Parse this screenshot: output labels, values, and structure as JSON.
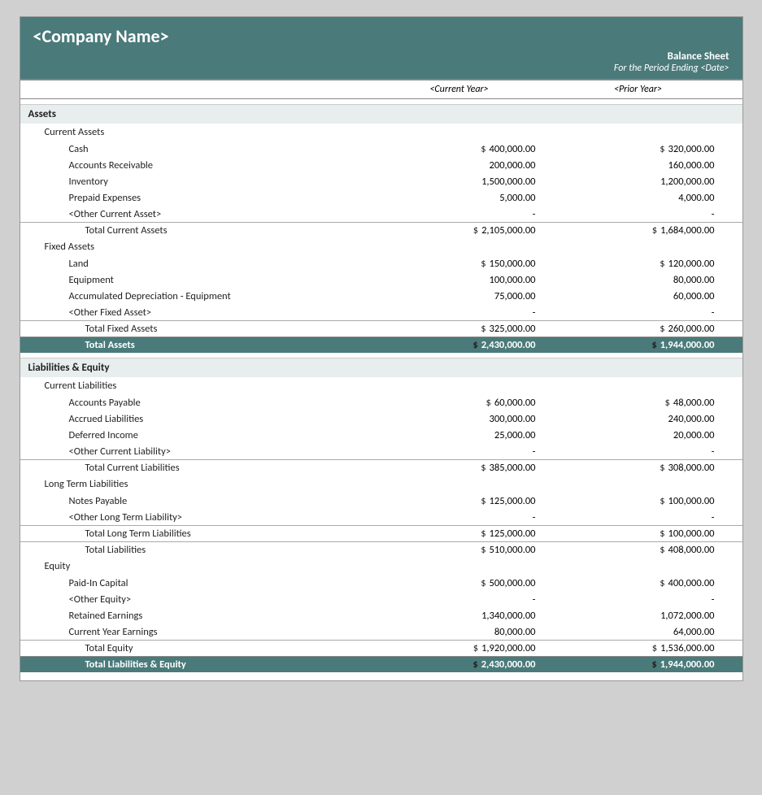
{
  "header": {
    "company_name": "<Company Name>",
    "doc_title": "Balance Sheet",
    "doc_subtitle": "For the Period Ending <Date>",
    "col_cy": "<Current Year>",
    "col_py": "<Prior Year>"
  },
  "sections": {
    "assets_label": "Assets",
    "current_assets_label": "Current Assets",
    "fixed_assets_label": "Fixed Assets",
    "liabilities_equity_label": "Liabilities & Equity",
    "current_liabilities_label": "Current Liabilities",
    "long_term_liabilities_label": "Long Term Liabilities",
    "equity_label": "Equity"
  },
  "rows": {
    "cash": {
      "label": "Cash",
      "cy": "400,000.00",
      "py": "320,000.00",
      "has_dollar_cy": true,
      "has_dollar_py": true
    },
    "accounts_receivable": {
      "label": "Accounts Receivable",
      "cy": "200,000.00",
      "py": "160,000.00"
    },
    "inventory": {
      "label": "Inventory",
      "cy": "1,500,000.00",
      "py": "1,200,000.00"
    },
    "prepaid_expenses": {
      "label": "Prepaid Expenses",
      "cy": "5,000.00",
      "py": "4,000.00"
    },
    "other_current_asset": {
      "label": "<Other Current Asset>",
      "cy": "-",
      "py": "-"
    },
    "total_current_assets": {
      "label": "Total Current Assets",
      "cy": "2,105,000.00",
      "py": "1,684,000.00",
      "has_dollar_cy": true,
      "has_dollar_py": true
    },
    "land": {
      "label": "Land",
      "cy": "150,000.00",
      "py": "120,000.00",
      "has_dollar_cy": true,
      "has_dollar_py": true
    },
    "equipment": {
      "label": "Equipment",
      "cy": "100,000.00",
      "py": "80,000.00"
    },
    "accum_depreciation": {
      "label": "Accumulated Depreciation - Equipment",
      "cy": "75,000.00",
      "py": "60,000.00"
    },
    "other_fixed_asset": {
      "label": "<Other Fixed Asset>",
      "cy": "-",
      "py": "-"
    },
    "total_fixed_assets": {
      "label": "Total Fixed Assets",
      "cy": "325,000.00",
      "py": "260,000.00",
      "has_dollar_cy": true,
      "has_dollar_py": true
    },
    "total_assets": {
      "label": "Total Assets",
      "cy": "2,430,000.00",
      "py": "1,944,000.00",
      "has_dollar_cy": true,
      "has_dollar_py": true
    },
    "accounts_payable": {
      "label": "Accounts Payable",
      "cy": "60,000.00",
      "py": "48,000.00",
      "has_dollar_cy": true,
      "has_dollar_py": true
    },
    "accrued_liabilities": {
      "label": "Accrued Liabilities",
      "cy": "300,000.00",
      "py": "240,000.00"
    },
    "deferred_income": {
      "label": "Deferred Income",
      "cy": "25,000.00",
      "py": "20,000.00"
    },
    "other_current_liability": {
      "label": "<Other Current Liability>",
      "cy": "-",
      "py": "-"
    },
    "total_current_liabilities": {
      "label": "Total Current Liabilities",
      "cy": "385,000.00",
      "py": "308,000.00",
      "has_dollar_cy": true,
      "has_dollar_py": true
    },
    "notes_payable": {
      "label": "Notes Payable",
      "cy": "125,000.00",
      "py": "100,000.00",
      "has_dollar_cy": true,
      "has_dollar_py": true
    },
    "other_lt_liability": {
      "label": "<Other Long Term Liability>",
      "cy": "-",
      "py": "-"
    },
    "total_lt_liabilities": {
      "label": "Total Long Term Liabilities",
      "cy": "125,000.00",
      "py": "100,000.00",
      "has_dollar_cy": true,
      "has_dollar_py": true
    },
    "total_liabilities": {
      "label": "Total Liabilities",
      "cy": "510,000.00",
      "py": "408,000.00",
      "has_dollar_cy": true,
      "has_dollar_py": true
    },
    "paid_in_capital": {
      "label": "Paid-In Capital",
      "cy": "500,000.00",
      "py": "400,000.00",
      "has_dollar_cy": true,
      "has_dollar_py": true
    },
    "other_equity": {
      "label": "<Other Equity>",
      "cy": "-",
      "py": "-"
    },
    "retained_earnings": {
      "label": "Retained Earnings",
      "cy": "1,340,000.00",
      "py": "1,072,000.00"
    },
    "current_year_earnings": {
      "label": "Current Year Earnings",
      "cy": "80,000.00",
      "py": "64,000.00"
    },
    "total_equity": {
      "label": "Total Equity",
      "cy": "1,920,000.00",
      "py": "1,536,000.00",
      "has_dollar_cy": true,
      "has_dollar_py": true
    },
    "total_liabilities_equity": {
      "label": "Total Liabilities & Equity",
      "cy": "2,430,000.00",
      "py": "1,944,000.00",
      "has_dollar_cy": true,
      "has_dollar_py": true
    }
  }
}
